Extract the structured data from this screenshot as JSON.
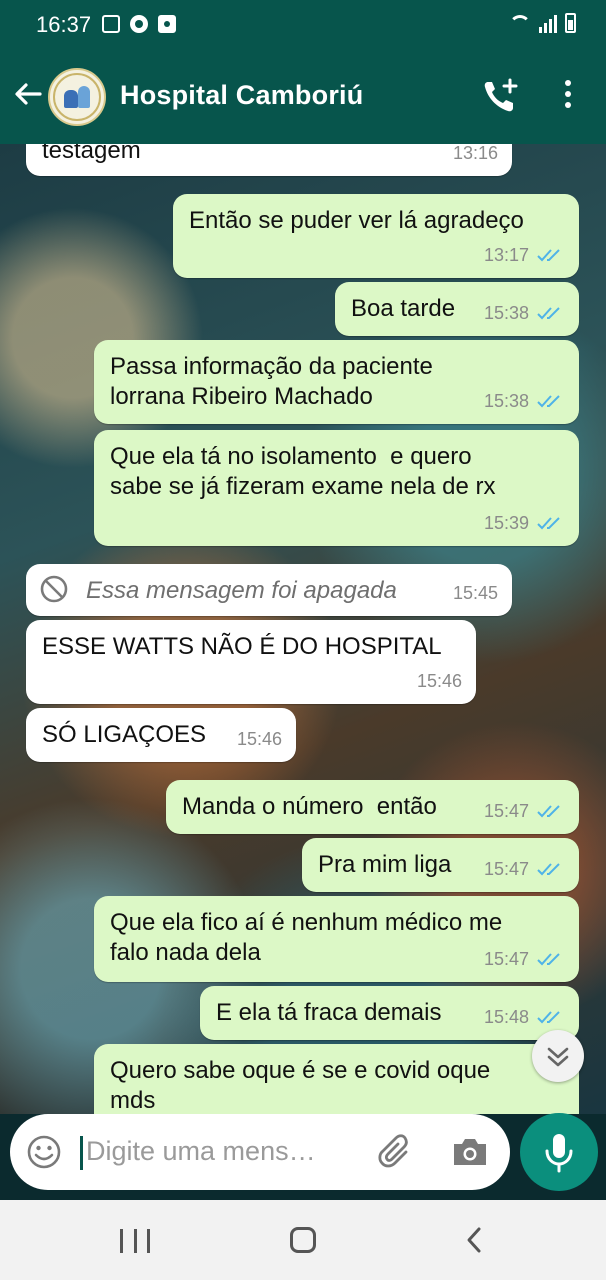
{
  "status_bar": {
    "time": "16:37",
    "icons": [
      "gallery-icon",
      "chrome-icon",
      "app-icon"
    ],
    "right_icons": [
      "wifi-icon",
      "signal-icon",
      "battery-icon"
    ]
  },
  "header": {
    "title": "Hospital Camboriú",
    "back_icon": "arrow-left-icon",
    "call_icon": "add-call-icon",
    "menu_icon": "more-vert-icon",
    "accent": "#07554c"
  },
  "messages": [
    {
      "dir": "in",
      "text": "testagem",
      "time": "13:16"
    },
    {
      "dir": "out",
      "text": "Então se puder ver lá agradeço",
      "time": "13:17",
      "read": true
    },
    {
      "dir": "out",
      "text": "Boa tarde",
      "time": "15:38",
      "read": true
    },
    {
      "dir": "out",
      "text": "Passa informação da paciente\nlorrana Ribeiro Machado",
      "time": "15:38",
      "read": true
    },
    {
      "dir": "out",
      "text": "Que ela tá no isolamento  e quero\nsabe se já fizeram exame nela de rx",
      "time": "15:39",
      "read": true
    },
    {
      "dir": "in",
      "deleted": true,
      "text": "Essa mensagem foi apagada",
      "time": "15:45"
    },
    {
      "dir": "in",
      "text": "ESSE WATTS NÃO É DO HOSPITAL",
      "time": "15:46"
    },
    {
      "dir": "in",
      "text": "SÓ LIGAÇOES",
      "time": "15:46"
    },
    {
      "dir": "out",
      "text": "Manda o número  então",
      "time": "15:47",
      "read": true
    },
    {
      "dir": "out",
      "text": "Pra mim liga",
      "time": "15:47",
      "read": true
    },
    {
      "dir": "out",
      "text": "Que ela fico aí é nenhum médico me\nfalo nada dela",
      "time": "15:47",
      "read": true
    },
    {
      "dir": "out",
      "text": "E ela tá fraca demais",
      "time": "15:48",
      "read": true
    },
    {
      "dir": "out",
      "text": "Quero sabe oque é se e covid oque\nmds",
      "time": "",
      "read": true
    }
  ],
  "colors": {
    "outgoing_bubble": "#dcf8c6",
    "incoming_bubble": "#ffffff",
    "read_ticks": "#4fb3e8",
    "fab": "#0b8f7d"
  },
  "composer": {
    "placeholder": "Digite uma mens…",
    "emoji_icon": "emoji-icon",
    "attach_icon": "paperclip-icon",
    "camera_icon": "camera-icon",
    "mic_icon": "mic-icon"
  },
  "scroll_button_icon": "double-chevron-down-icon",
  "nav": [
    "recent-apps-icon",
    "home-icon",
    "back-icon"
  ]
}
